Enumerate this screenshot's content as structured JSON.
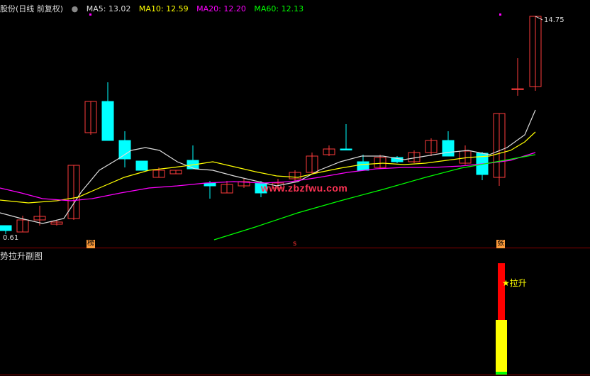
{
  "header": {
    "title": "股份(日线 前复权)",
    "ma": [
      {
        "label": "MA5: 13.02",
        "color": "#dddddd"
      },
      {
        "label": "MA10: 12.59",
        "color": "#ffff00"
      },
      {
        "label": "MA20: 12.20",
        "color": "#ff00ff"
      },
      {
        "label": "MA60: 12.13",
        "color": "#00ff00"
      }
    ]
  },
  "price_labels": {
    "high": "14.75",
    "low": "0.61"
  },
  "badges": [
    {
      "text": "榜",
      "color": "#ff6a00"
    },
    {
      "text": "s",
      "color": "#ff3030"
    },
    {
      "text": "张",
      "color": "#ff6a00"
    }
  ],
  "watermark": "www.zbzfwu.com",
  "sub_panel": {
    "title": "势拉升副图",
    "signal_label": "★拉升"
  },
  "colors": {
    "up": "#ff3b3b",
    "down": "#00ffff",
    "ma5": "#dddddd",
    "ma10": "#ffff00",
    "ma20": "#ff00ff",
    "ma60": "#00ff00"
  }
}
